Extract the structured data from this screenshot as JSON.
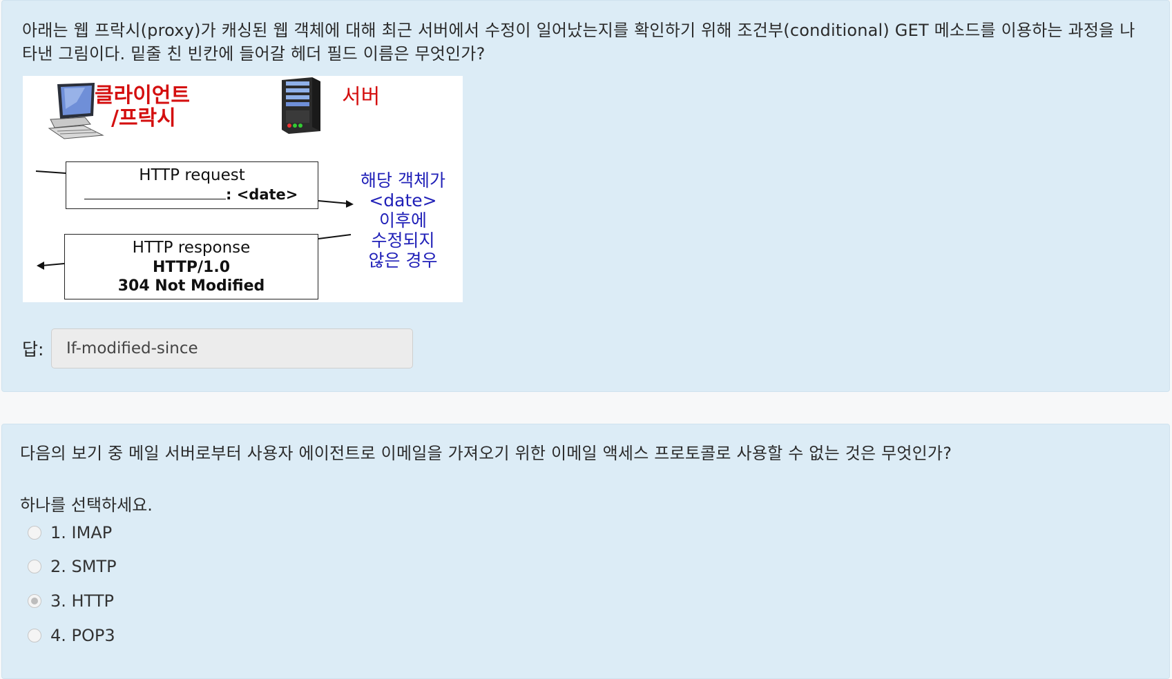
{
  "question1": {
    "text": "아래는 웹 프락시(proxy)가 캐싱된 웹 객체에 대해 최근 서버에서 수정이 일어났는지를 확인하기 위해 조건부(conditional) GET 메소드를 이용하는 과정을 나타낸 그림이다. 밑줄 친 빈칸에 들어갈 헤더 필드 이름은 무엇인가?",
    "figure": {
      "client_label_line1": "클라이언트",
      "client_label_line2": "/프락시",
      "server_label": "서버",
      "request_title": "HTTP request",
      "request_suffix": ": <date>",
      "response_title": "HTTP response",
      "response_line2": "HTTP/1.0",
      "response_line3": "304 Not Modified",
      "note_line1": "해당 객체가",
      "note_line2": "<date>",
      "note_line3": "이후에",
      "note_line4": "수정되지",
      "note_line5": "않은 경우"
    },
    "answer_label": "답:",
    "answer_value": "If-modified-since"
  },
  "question2": {
    "text": "다음의 보기 중 메일 서버로부터 사용자 에이전트로 이메일을 가져오기 위한 이메일 액세스 프로토콜로 사용할 수 없는 것은 무엇인가?",
    "select_hint": "하나를 선택하세요.",
    "options": [
      {
        "label": "1. IMAP",
        "selected": false
      },
      {
        "label": "2. SMTP",
        "selected": false
      },
      {
        "label": "3. HTTP",
        "selected": true
      },
      {
        "label": "4. POP3",
        "selected": false
      }
    ]
  },
  "colors": {
    "panel_bg": "#dcecf6",
    "figure_red": "#d40f0f",
    "figure_blue": "#2020b8"
  }
}
